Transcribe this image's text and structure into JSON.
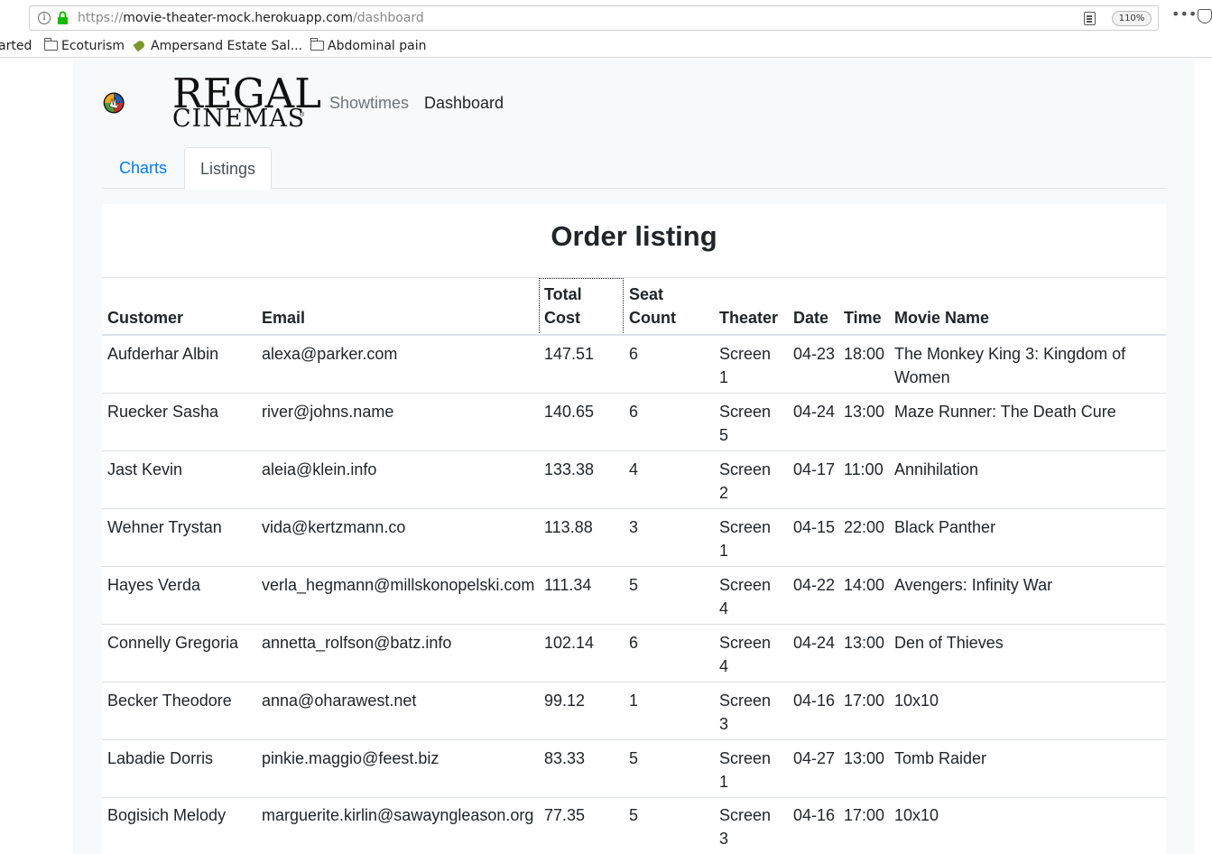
{
  "browser": {
    "url_scheme": "https://",
    "url_host": "movie-theater-mock.herokuapp.com",
    "url_path": "/dashboard",
    "zoom": "110%",
    "more_label": "•••",
    "bookmarks": [
      {
        "label": "arted",
        "icon": "none"
      },
      {
        "label": "Ecoturism",
        "icon": "folder-icon"
      },
      {
        "label": "Ampersand Estate Sal...",
        "icon": "tag-icon"
      },
      {
        "label": "Abdominal pain",
        "icon": "folder-icon"
      }
    ]
  },
  "brand": {
    "line1": "REGAL",
    "line2": "CINEMAS",
    "mark": "®",
    "colors": {
      "yellow": "#f2a81d",
      "green": "#4b9c3a",
      "red": "#d42a2a",
      "blue": "#2a5ca8",
      "ring": "#111111"
    }
  },
  "nav": {
    "showtimes": "Showtimes",
    "dashboard": "Dashboard"
  },
  "tabs": {
    "charts": "Charts",
    "listings": "Listings"
  },
  "listing": {
    "title": "Order listing",
    "headers": {
      "customer": "Customer",
      "email": "Email",
      "total_cost_1": "Total",
      "total_cost_2": "Cost",
      "seat_count_1": "Seat",
      "seat_count_2": "Count",
      "theater": "Theater",
      "date": "Date",
      "time": "Time",
      "movie_name": "Movie Name"
    },
    "rows": [
      {
        "customer": "Aufderhar Albin",
        "email": "alexa@parker.com",
        "cost": "147.51",
        "seats": "6",
        "theater": "Screen 1",
        "date": "04-23",
        "time": "18:00",
        "movie": "The Monkey King 3: Kingdom of Women"
      },
      {
        "customer": "Ruecker Sasha",
        "email": "river@johns.name",
        "cost": "140.65",
        "seats": "6",
        "theater": "Screen 5",
        "date": "04-24",
        "time": "13:00",
        "movie": "Maze Runner: The Death Cure"
      },
      {
        "customer": "Jast Kevin",
        "email": "aleia@klein.info",
        "cost": "133.38",
        "seats": "4",
        "theater": "Screen 2",
        "date": "04-17",
        "time": "11:00",
        "movie": "Annihilation"
      },
      {
        "customer": "Wehner Trystan",
        "email": "vida@kertzmann.co",
        "cost": "113.88",
        "seats": "3",
        "theater": "Screen 1",
        "date": "04-15",
        "time": "22:00",
        "movie": "Black Panther"
      },
      {
        "customer": "Hayes Verda",
        "email": "verla_hegmann@millskonopelski.com",
        "cost": "111.34",
        "seats": "5",
        "theater": "Screen 4",
        "date": "04-22",
        "time": "14:00",
        "movie": "Avengers: Infinity War"
      },
      {
        "customer": "Connelly Gregoria",
        "email": "annetta_rolfson@batz.info",
        "cost": "102.14",
        "seats": "6",
        "theater": "Screen 4",
        "date": "04-24",
        "time": "13:00",
        "movie": "Den of Thieves"
      },
      {
        "customer": "Becker Theodore",
        "email": "anna@oharawest.net",
        "cost": "99.12",
        "seats": "1",
        "theater": "Screen 3",
        "date": "04-16",
        "time": "17:00",
        "movie": "10x10"
      },
      {
        "customer": "Labadie Dorris",
        "email": "pinkie.maggio@feest.biz",
        "cost": "83.33",
        "seats": "5",
        "theater": "Screen 1",
        "date": "04-27",
        "time": "13:00",
        "movie": "Tomb Raider"
      },
      {
        "customer": "Bogisich Melody",
        "email": "marguerite.kirlin@sawayngleason.org",
        "cost": "77.35",
        "seats": "5",
        "theater": "Screen 3",
        "date": "04-16",
        "time": "17:00",
        "movie": "10x10"
      }
    ]
  }
}
